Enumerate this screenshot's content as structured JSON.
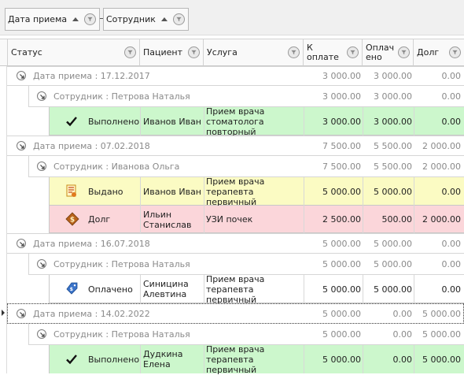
{
  "group_panel": {
    "chips": [
      {
        "label": "Дата приема"
      },
      {
        "label": "Сотрудник"
      }
    ]
  },
  "columns": {
    "status": "Статус",
    "patient": "Пациент",
    "service": "Услуга",
    "to_pay_line1": "К",
    "to_pay_line2": "оплате",
    "paid_line1": "Оплач",
    "paid_line2": "ено",
    "debt": "Долг"
  },
  "groups": [
    {
      "date_label": "Дата приема : 17.12.2017",
      "to_pay": "3 000.00",
      "paid": "3 000.00",
      "debt": "0.00",
      "employee": {
        "label": "Сотрудник : Петрова Наталья",
        "to_pay": "3 000.00",
        "paid": "3 000.00",
        "debt": "0.00"
      },
      "rows": [
        {
          "status": "Выполнено",
          "icon": "checkmark-icon",
          "patient": "Иванов Иван",
          "service_l1": "Прием врача",
          "service_l2": "стоматолога повторный",
          "to_pay": "3 000.00",
          "paid": "3 000.00",
          "debt": "0.00",
          "color": "#ccf7cc"
        }
      ]
    },
    {
      "date_label": "Дата приема : 07.02.2018",
      "to_pay": "7 500.00",
      "paid": "5 500.00",
      "debt": "2 000.00",
      "employee": {
        "label": "Сотрудник : Иванова Ольга",
        "to_pay": "7 500.00",
        "paid": "5 500.00",
        "debt": "2 000.00"
      },
      "rows": [
        {
          "status": "Выдано",
          "icon": "invoice-icon",
          "patient": "Иванов Иван",
          "service_l1": "Прием врача терапевта",
          "service_l2": "первичный",
          "to_pay": "5 000.00",
          "paid": "5 000.00",
          "debt": "0.00",
          "color": "#fbfbc3"
        },
        {
          "status": "Долг",
          "icon": "debt-coin-icon",
          "patient_l1": "Ильин",
          "patient_l2": "Станислав",
          "service": "УЗИ почек",
          "to_pay": "2 500.00",
          "paid": "500.00",
          "debt": "2 000.00",
          "color": "#fbd6da"
        }
      ]
    },
    {
      "date_label": "Дата приема : 16.07.2018",
      "to_pay": "5 000.00",
      "paid": "5 000.00",
      "debt": "0.00",
      "employee": {
        "label": "Сотрудник : Петрова Наталья",
        "to_pay": "5 000.00",
        "paid": "5 000.00",
        "debt": "0.00"
      },
      "rows": [
        {
          "status": "Оплачено",
          "icon": "paid-tag-icon",
          "patient_l1": "Синицина",
          "patient_l2": "Алевтина",
          "service_l1": "Прием врача терапевта",
          "service_l2": "первичный",
          "to_pay": "5 000.00",
          "paid": "5 000.00",
          "debt": "0.00",
          "color": "#ffffff"
        }
      ]
    },
    {
      "date_label": "Дата приема : 14.02.2022",
      "to_pay": "5 000.00",
      "paid": "0.00",
      "debt": "5 000.00",
      "employee": {
        "label": "Сотрудник : Петрова Наталья",
        "to_pay": "5 000.00",
        "paid": "0.00",
        "debt": "5 000.00"
      },
      "rows": [
        {
          "status": "Выполнено",
          "icon": "checkmark-icon",
          "patient_l1": "Дудкина",
          "patient_l2": "Елена",
          "service_l1": "Прием врача терапевта",
          "service_l2": "первичный",
          "to_pay": "5 000.00",
          "paid": "0.00",
          "debt": "5 000.00",
          "color": "#ccf7cc"
        }
      ]
    }
  ]
}
